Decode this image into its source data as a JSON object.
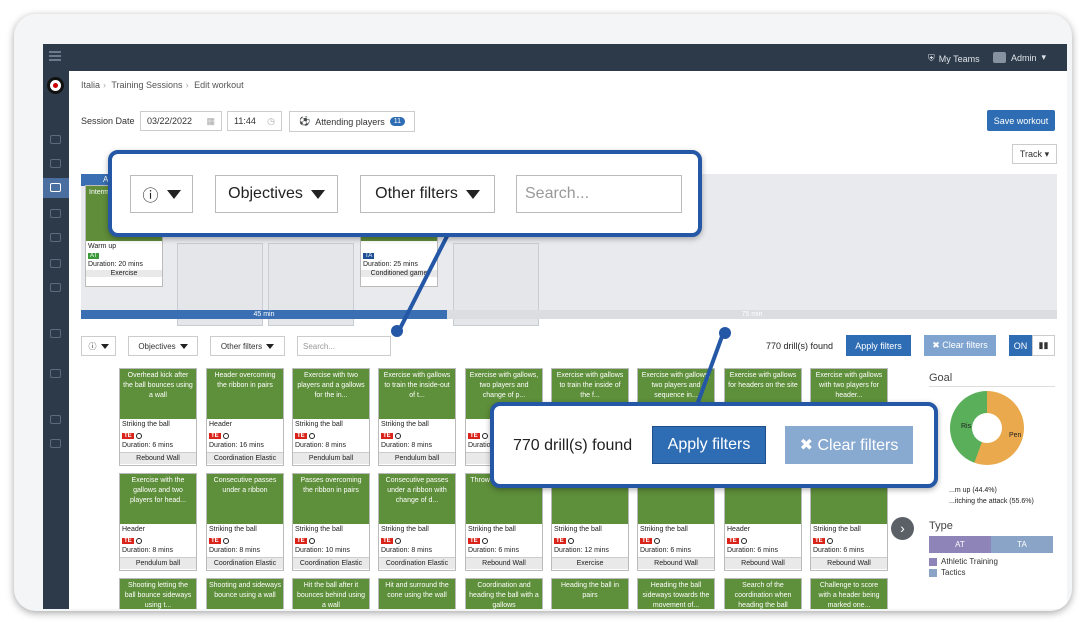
{
  "topbar": {
    "my_teams": "My Teams",
    "admin": "Admin"
  },
  "breadcrumb": [
    "Italia",
    "Training Sessions",
    "Edit workout"
  ],
  "session": {
    "label": "Session Date",
    "date": "03/22/2022",
    "time": "11:44",
    "attending": "Attending players",
    "attending_count": "11"
  },
  "buttons": {
    "save": "Save workout",
    "track": "Track"
  },
  "workout": [
    {
      "title": "Intermi... - Dribbl...",
      "cat": "Warm up",
      "tag": "AT",
      "duration": "Duration: 20 mins",
      "type": "Exercise"
    },
    {
      "title": "",
      "cat": "",
      "tag": "TA",
      "duration": "Duration: 25 mins",
      "type": "Conditioned game"
    }
  ],
  "workout_header": "Att",
  "progress": {
    "done": "45 min",
    "total": "75 min"
  },
  "filters": {
    "objectives": "Objectives",
    "other": "Other filters",
    "search_placeholder": "Search...",
    "found": "770 drill(s) found",
    "apply": "Apply filters",
    "clear": "✖ Clear filters",
    "on": "ON"
  },
  "drills": [
    {
      "title": "Overhead kick after the ball bounces using a wall",
      "skill": "Striking the ball",
      "duration": "Duration: 6 mins",
      "equipment": "Rebound Wall"
    },
    {
      "title": "Header overcoming the ribbon in pairs",
      "skill": "Header",
      "duration": "Duration: 16 mins",
      "equipment": "Coordination Elastic"
    },
    {
      "title": "Exercise with two players and a gallows for the in...",
      "skill": "Striking the ball",
      "duration": "Duration: 8 mins",
      "equipment": "Pendulum ball"
    },
    {
      "title": "Exercise with gallows to train the inside-out of t...",
      "skill": "Striking the ball",
      "duration": "Duration: 8 mins",
      "equipment": "Pendulum ball"
    },
    {
      "title": "Exercise with gallows, two players and change of p...",
      "skill": "",
      "duration": "Duration: ...",
      "equipment": ""
    },
    {
      "title": "Exercise with gallows to train the inside of the f...",
      "skill": "",
      "duration": "",
      "equipment": ""
    },
    {
      "title": "Exercise with gallows, two players and sequence in...",
      "skill": "",
      "duration": "",
      "equipment": ""
    },
    {
      "title": "Exercise with gallows for headers on the site",
      "skill": "",
      "duration": "",
      "equipment": ""
    },
    {
      "title": "Exercise with gallows with two players for header...",
      "skill": "",
      "duration": "",
      "equipment": ""
    },
    {
      "title": "Exercise with the gallows and two players for head...",
      "skill": "Header",
      "duration": "Duration: 8 mins",
      "equipment": "Pendulum ball"
    },
    {
      "title": "Consecutive passes under a ribbon",
      "skill": "Striking the ball",
      "duration": "Duration: 8 mins",
      "equipment": "Coordination Elastic"
    },
    {
      "title": "Passes overcoming the ribbon in pairs",
      "skill": "Striking the ball",
      "duration": "Duration: 10 mins",
      "equipment": "Coordination Elastic"
    },
    {
      "title": "Consecutive passes under a ribbon with change of d...",
      "skill": "Striking the ball",
      "duration": "Duration: 8 mins",
      "equipment": "Coordination Elastic"
    },
    {
      "title": "Throw and... using t...",
      "skill": "Striking the ball",
      "duration": "Duration: 6 mins",
      "equipment": "Rebound Wall"
    },
    {
      "title": "",
      "skill": "Striking the ball",
      "duration": "Duration: 12 mins",
      "equipment": "Exercise"
    },
    {
      "title": "",
      "skill": "Striking the ball",
      "duration": "Duration: 6 mins",
      "equipment": "Rebound Wall"
    },
    {
      "title": "",
      "skill": "Header",
      "duration": "Duration: 6 mins",
      "equipment": "Rebound Wall"
    },
    {
      "title": "",
      "skill": "Striking the ball",
      "duration": "Duration: 6 mins",
      "equipment": "Rebound Wall"
    },
    {
      "title": "Shooting letting the ball bounce sideways using t...",
      "skill": "",
      "duration": "",
      "equipment": ""
    },
    {
      "title": "Shooting and sideways bounce using a wall",
      "skill": "",
      "duration": "",
      "equipment": ""
    },
    {
      "title": "Hit the ball after it bounces behind using a wall",
      "skill": "",
      "duration": "",
      "equipment": ""
    },
    {
      "title": "Hit and surround the cone using the wall",
      "skill": "",
      "duration": "",
      "equipment": ""
    },
    {
      "title": "Coordination and heading the ball with a gallows",
      "skill": "",
      "duration": "",
      "equipment": ""
    },
    {
      "title": "Heading the ball in pairs",
      "skill": "",
      "duration": "",
      "equipment": ""
    },
    {
      "title": "Heading the ball sideways towards the movement of...",
      "skill": "",
      "duration": "",
      "equipment": ""
    },
    {
      "title": "Search of the coordination when heading the ball",
      "skill": "",
      "duration": "",
      "equipment": ""
    },
    {
      "title": "Challenge to score with a header being marked one...",
      "skill": "",
      "duration": "",
      "equipment": ""
    }
  ],
  "tag_te": "TE",
  "goal": {
    "title": "Goal",
    "slice_a": "Ris",
    "slice_b": "Pen",
    "legend1": "...m up (44.4%)",
    "legend2": "...itching the attack (55.6%)"
  },
  "type": {
    "title": "Type",
    "at": "AT",
    "ta": "TA",
    "legend_at": "Athletic Training",
    "legend_ta": "Tactics"
  },
  "colors": {
    "accent": "#2e6db4",
    "dark": "#2d3a4a",
    "pitch": "#5e8f3a"
  }
}
